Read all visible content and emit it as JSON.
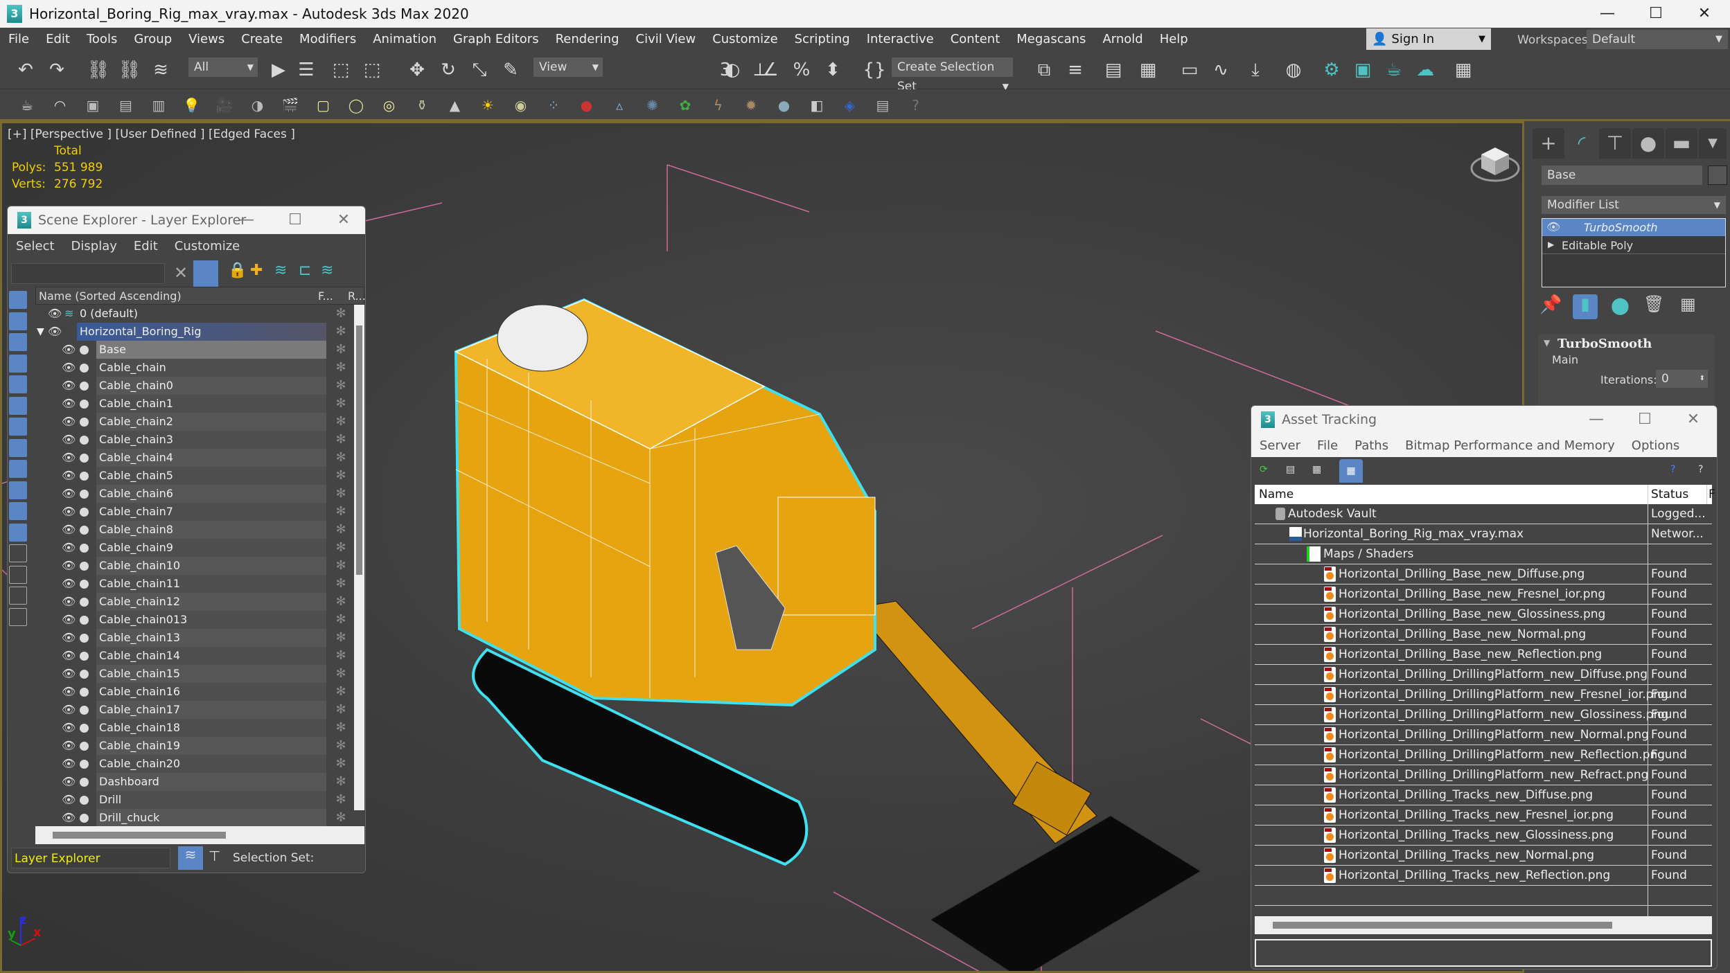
{
  "window": {
    "title": "Horizontal_Boring_Rig_max_vray.max - Autodesk 3ds Max 2020",
    "app_icon": "3dsmax-logo-icon",
    "controls": {
      "minimize": "—",
      "maximize": "☐",
      "close": "✕"
    }
  },
  "menubar": {
    "items": [
      "File",
      "Edit",
      "Tools",
      "Group",
      "Views",
      "Create",
      "Modifiers",
      "Animation",
      "Graph Editors",
      "Rendering",
      "Civil View",
      "Customize",
      "Scripting",
      "Interactive",
      "Content",
      "Megascans",
      "Arnold",
      "Help"
    ],
    "sign_in": "Sign In",
    "workspaces_label": "Workspaces:",
    "workspace_value": "Default"
  },
  "toolbar": {
    "selection_filter": "All",
    "reference_coord": "View",
    "create_selection_set": "Create Selection Set",
    "icons_row1": [
      "undo-icon",
      "redo-icon",
      "link-icon",
      "unlink-icon",
      "bind-space-warp-icon",
      "select-object-icon",
      "select-by-name-icon",
      "rect-selection-icon",
      "window-crossing-icon",
      "move-icon",
      "rotate-icon",
      "scale-icon",
      "select-manipulate-icon",
      "mirror-icon",
      "align-icon",
      "snap-3d-icon",
      "angle-snap-icon",
      "percent-snap-icon",
      "spinner-snap-icon",
      "edit-named-selection-icon",
      "mirror-tool-icon",
      "align-tool-icon",
      "layer-manager-icon",
      "scene-explorer-icon",
      "toggle-ribbon-icon",
      "curve-editor-icon",
      "schematic-view-icon",
      "material-editor-icon",
      "render-setup-icon",
      "rendered-frame-window-icon",
      "render-production-icon",
      "render-cloud-icon",
      "viewport-layouts-icon"
    ],
    "icons_row2": [
      "teapot-icon",
      "shape-icon",
      "layer-icon",
      "list-icon",
      "list2-icon",
      "light-icon",
      "camera-icon",
      "physical-camera-icon",
      "target-camera-icon",
      "plane-light-icon",
      "sphere-light-icon",
      "dome-light-icon",
      "mesh-light-icon",
      "cone-light-icon",
      "sun-icon",
      "ies-icon",
      "particles-icon",
      "proxy-icon",
      "tree-icon",
      "scatter-icon",
      "grass-icon",
      "hair-icon",
      "fur-icon",
      "sphere-icon",
      "material-icon",
      "bounding-icon",
      "script-icon",
      "help-icon"
    ]
  },
  "viewport": {
    "label": "[+] [Perspective ] [User Defined ] [Edged Faces ]",
    "stats_header": "Total",
    "polys_label": "Polys:",
    "polys_value": "551 989",
    "verts_label": "Verts:",
    "verts_value": "276 792",
    "axis": {
      "x": "x",
      "y": "y",
      "z": "z"
    }
  },
  "command_panel": {
    "tabs": [
      "create-tab-icon",
      "modify-tab-icon",
      "hierarchy-tab-icon",
      "motion-tab-icon",
      "display-tab-icon",
      "utilities-tab-icon"
    ],
    "object_name": "Base",
    "modifier_list": "Modifier List",
    "stack": [
      {
        "label": "TurboSmooth",
        "selected": true
      },
      {
        "label": "Editable Poly",
        "selected": false
      }
    ],
    "rollout_title": "TurboSmooth",
    "group_label": "Main",
    "iterations_label": "Iterations:",
    "iterations_value": "0"
  },
  "scene_explorer": {
    "title": "Scene Explorer - Layer Explorer",
    "menu": [
      "Select",
      "Display",
      "Edit",
      "Customize"
    ],
    "search_placeholder": "",
    "columns": {
      "name": "Name (Sorted Ascending)",
      "frozen": "F...",
      "renderable": "R..."
    },
    "layers": [
      {
        "name": "0 (default)",
        "type": "layer"
      },
      {
        "name": "Horizontal_Boring_Rig",
        "type": "layer",
        "selected": true,
        "expanded": true
      }
    ],
    "objects": [
      "Base",
      "Cable_chain",
      "Cable_chain0",
      "Cable_chain1",
      "Cable_chain2",
      "Cable_chain3",
      "Cable_chain4",
      "Cable_chain5",
      "Cable_chain6",
      "Cable_chain7",
      "Cable_chain8",
      "Cable_chain9",
      "Cable_chain10",
      "Cable_chain11",
      "Cable_chain12",
      "Cable_chain013",
      "Cable_chain13",
      "Cable_chain14",
      "Cable_chain15",
      "Cable_chain16",
      "Cable_chain17",
      "Cable_chain18",
      "Cable_chain19",
      "Cable_chain20",
      "Dashboard",
      "Drill",
      "Drill_chuck"
    ],
    "highlighted_object": "Base",
    "footer_mode": "Layer Explorer",
    "selection_set_label": "Selection Set:"
  },
  "asset_tracking": {
    "title": "Asset Tracking",
    "menu": [
      "Server",
      "File",
      "Paths",
      "Bitmap Performance and Memory",
      "Options"
    ],
    "columns": {
      "name": "Name",
      "status": "Status",
      "extra": "F"
    },
    "rows": [
      {
        "name": "Autodesk Vault",
        "status": "Logged...",
        "level": 0,
        "icon": "vault-icon"
      },
      {
        "name": "Horizontal_Boring_Rig_max_vray.max",
        "status": "Networ...",
        "level": 1,
        "icon": "max-file-icon"
      },
      {
        "name": "Maps / Shaders",
        "status": "",
        "level": 2,
        "icon": "maps-folder-icon"
      },
      {
        "name": "Horizontal_Drilling_Base_new_Diffuse.png",
        "status": "Found",
        "level": 3,
        "icon": "png-file-icon"
      },
      {
        "name": "Horizontal_Drilling_Base_new_Fresnel_ior.png",
        "status": "Found",
        "level": 3,
        "icon": "png-file-icon"
      },
      {
        "name": "Horizontal_Drilling_Base_new_Glossiness.png",
        "status": "Found",
        "level": 3,
        "icon": "png-file-icon"
      },
      {
        "name": "Horizontal_Drilling_Base_new_Normal.png",
        "status": "Found",
        "level": 3,
        "icon": "png-file-icon"
      },
      {
        "name": "Horizontal_Drilling_Base_new_Reflection.png",
        "status": "Found",
        "level": 3,
        "icon": "png-file-icon"
      },
      {
        "name": "Horizontal_Drilling_DrillingPlatform_new_Diffuse.png",
        "status": "Found",
        "level": 3,
        "icon": "png-file-icon"
      },
      {
        "name": "Horizontal_Drilling_DrillingPlatform_new_Fresnel_ior.png",
        "status": "Found",
        "level": 3,
        "icon": "png-file-icon"
      },
      {
        "name": "Horizontal_Drilling_DrillingPlatform_new_Glossiness.png",
        "status": "Found",
        "level": 3,
        "icon": "png-file-icon"
      },
      {
        "name": "Horizontal_Drilling_DrillingPlatform_new_Normal.png",
        "status": "Found",
        "level": 3,
        "icon": "png-file-icon"
      },
      {
        "name": "Horizontal_Drilling_DrillingPlatform_new_Reflection.png",
        "status": "Found",
        "level": 3,
        "icon": "png-file-icon"
      },
      {
        "name": "Horizontal_Drilling_DrillingPlatform_new_Refract.png",
        "status": "Found",
        "level": 3,
        "icon": "png-file-icon"
      },
      {
        "name": "Horizontal_Drilling_Tracks_new_Diffuse.png",
        "status": "Found",
        "level": 3,
        "icon": "png-file-icon"
      },
      {
        "name": "Horizontal_Drilling_Tracks_new_Fresnel_ior.png",
        "status": "Found",
        "level": 3,
        "icon": "png-file-icon"
      },
      {
        "name": "Horizontal_Drilling_Tracks_new_Glossiness.png",
        "status": "Found",
        "level": 3,
        "icon": "png-file-icon"
      },
      {
        "name": "Horizontal_Drilling_Tracks_new_Normal.png",
        "status": "Found",
        "level": 3,
        "icon": "png-file-icon"
      },
      {
        "name": "Horizontal_Drilling_Tracks_new_Reflection.png",
        "status": "Found",
        "level": 3,
        "icon": "png-file-icon"
      }
    ]
  },
  "colors": {
    "accent_blue": "#5b86c6",
    "selection_cyan": "#3fe0f0",
    "model_yellow": "#e6a410",
    "stats_yellow": "#f0d000",
    "viewport_border": "#7a6a2f"
  }
}
